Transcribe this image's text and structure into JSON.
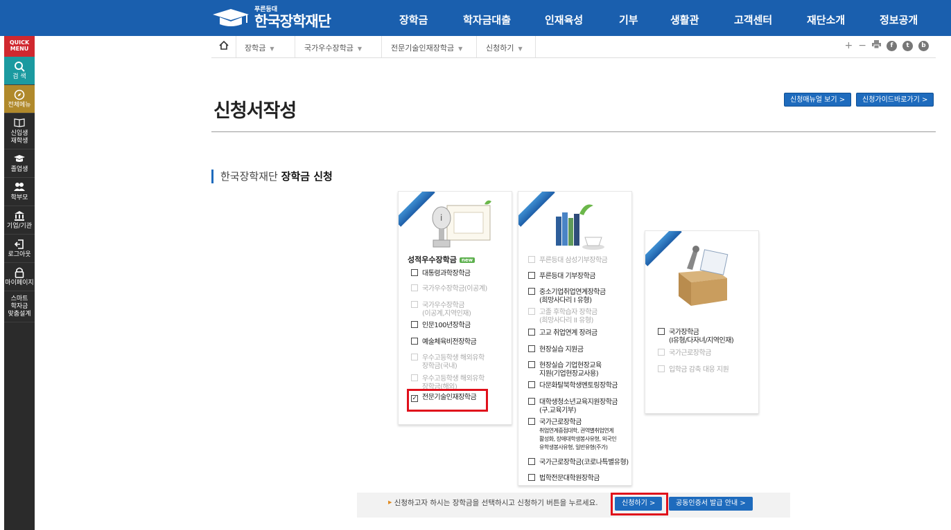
{
  "header": {
    "logo_small": "푸른등대",
    "logo_big": "한국장학재단",
    "nav": [
      "장학금",
      "학자금대출",
      "인재육성",
      "기부",
      "생활관",
      "고객센터",
      "재단소개",
      "정보공개"
    ]
  },
  "quick_menu": {
    "title": "QUICK MENU",
    "items": [
      {
        "label": "검 색",
        "icon": "search-icon"
      },
      {
        "label": "전체메뉴",
        "icon": "compass-icon"
      },
      {
        "label": "신입생\n재학생",
        "icon": "book-icon"
      },
      {
        "label": "졸업생",
        "icon": "graduation-cap-icon"
      },
      {
        "label": "학부모",
        "icon": "people-icon"
      },
      {
        "label": "기업/기관",
        "icon": "bank-icon"
      },
      {
        "label": "로그아웃",
        "icon": "logout-icon"
      },
      {
        "label": "마이페이지",
        "icon": "lock-icon"
      },
      {
        "label": "스마트\n학자금\n맞춤설계",
        "icon": ""
      }
    ]
  },
  "breadcrumb": {
    "home_icon": "home-icon",
    "items": [
      "장학금",
      "국가우수장학금",
      "전문기술인재장학금",
      "신청하기"
    ]
  },
  "tools": {
    "plus": "+",
    "minus": "−",
    "print": "print-icon",
    "facebook": "f",
    "twitter": "t",
    "blog": "b"
  },
  "page": {
    "title": "신청서작성",
    "manual_btn": "신청매뉴얼 보기 >",
    "guide_btn": "신청가이드바로가기 >",
    "subheading_prefix": "한국장학재단 ",
    "subheading_bold": "장학금 신청"
  },
  "card1": {
    "category": "성적우수장학금",
    "badge": "new",
    "options": [
      {
        "label": "대통령과학장학금",
        "sub": "",
        "enabled": true,
        "checked": false
      },
      {
        "label": "국가우수장학금(이공계)",
        "sub": "",
        "enabled": false,
        "checked": false
      },
      {
        "label": "국가우수장학금",
        "sub": "(이공계,지역인재)",
        "enabled": false,
        "checked": false
      },
      {
        "label": "인문100년장학금",
        "sub": "",
        "enabled": true,
        "checked": false
      },
      {
        "label": "예술체육비전장학금",
        "sub": "",
        "enabled": true,
        "checked": false
      },
      {
        "label": "우수고등학생 해외유학",
        "sub": "장학금(국내)",
        "enabled": false,
        "checked": false
      },
      {
        "label": "우수고등학생 해외유학",
        "sub": "장학금(해외)",
        "enabled": false,
        "checked": false
      },
      {
        "label": "전문기술인재장학금",
        "sub": "",
        "enabled": true,
        "checked": true
      }
    ]
  },
  "card2": {
    "options": [
      {
        "label": "푸른등대 삼성기부장학금",
        "sub": "",
        "enabled": false
      },
      {
        "label": "푸른등대 기부장학금",
        "sub": "",
        "enabled": true
      },
      {
        "label": "중소기업취업연계장학금",
        "sub": "(희망사다리 I 유형)",
        "enabled": true
      },
      {
        "label": "고졸 후학습자 장학금",
        "sub": "(희망사다리 II 유형)",
        "enabled": false
      },
      {
        "label": "고교 취업연계 장려금",
        "sub": "",
        "enabled": true
      },
      {
        "label": "현장실습 지원금",
        "sub": "",
        "enabled": true
      },
      {
        "label": "현장실습 기업현장교육",
        "sub": "지원(기업현장교사용)",
        "enabled": true
      },
      {
        "label": "다문화탈북학생멘토링장학금",
        "sub": "",
        "enabled": true
      },
      {
        "label": "대학생청소년교육지원장학금",
        "sub": "(구.교육기부)",
        "enabled": true
      },
      {
        "label": "국가근로장학금",
        "sub": "취업연계중점대학, 권역별취업연계\n활성화, 장애대학생봉사유형, 외국인\n유학생봉사유형, 일반유형(주가)",
        "enabled": true
      },
      {
        "label": "국가근로장학금(코로나특별유형)",
        "sub": "",
        "enabled": true
      },
      {
        "label": "법학전문대학원장학금",
        "sub": "",
        "enabled": true
      }
    ]
  },
  "card3": {
    "options": [
      {
        "label": "국가장학금",
        "sub": "(I유형/다자녀/지역인재)",
        "enabled": true
      },
      {
        "label": "국가근로장학금",
        "sub": "",
        "enabled": false
      },
      {
        "label": "입학금 감축 대응 지원",
        "sub": "",
        "enabled": false
      }
    ]
  },
  "bottom": {
    "guide_text": "신청하고자 하시는 장학금을 선택하시고 신청하기 버튼을 누르세요.",
    "apply_btn": "신청하기 >",
    "cert_btn": "공동인증서 발급 안내 >"
  },
  "colors": {
    "brand_blue": "#1a5fae",
    "highlight_red": "#e0101b",
    "quick_red": "#d0282f"
  }
}
